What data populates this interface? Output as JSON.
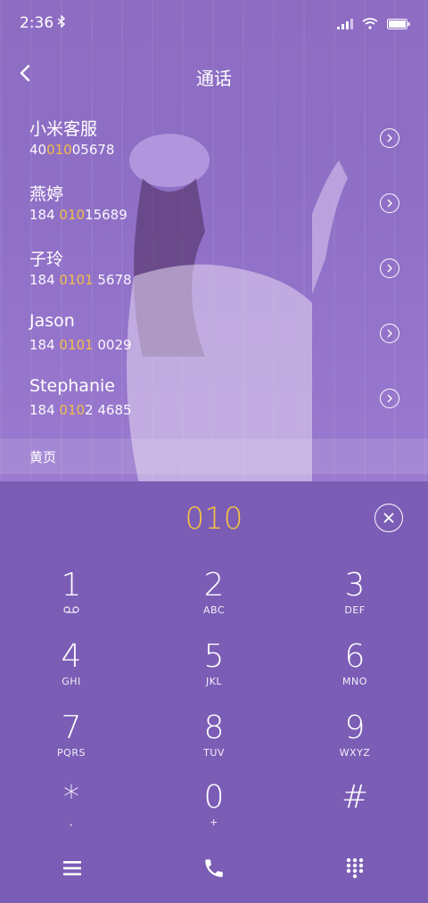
{
  "status_bar": {
    "time": "2:36"
  },
  "header": {
    "title": "通话"
  },
  "contacts": [
    {
      "name": "小米客服",
      "number_pre": "40",
      "number_hl": "010",
      "number_post": "05678"
    },
    {
      "name": "燕婷",
      "number_pre": "184 ",
      "number_hl": "010",
      "number_post": "15689"
    },
    {
      "name": "子玲",
      "number_pre": "184 ",
      "number_hl": "0101",
      "number_post": " 5678"
    },
    {
      "name": "Jason",
      "number_pre": "184 ",
      "number_hl": "0101",
      "number_post": " 0029"
    },
    {
      "name": "Stephanie",
      "number_pre": "184 ",
      "number_hl": "010",
      "number_post": "2 4685"
    }
  ],
  "yellow_pages": {
    "label": "黄页"
  },
  "dialer": {
    "typed_number": "010",
    "keys": [
      {
        "digit": "1",
        "letters": ""
      },
      {
        "digit": "2",
        "letters": "ABC"
      },
      {
        "digit": "3",
        "letters": "DEF"
      },
      {
        "digit": "4",
        "letters": "GHI"
      },
      {
        "digit": "5",
        "letters": "JKL"
      },
      {
        "digit": "6",
        "letters": "MNO"
      },
      {
        "digit": "7",
        "letters": "PQRS"
      },
      {
        "digit": "8",
        "letters": "TUV"
      },
      {
        "digit": "9",
        "letters": "WXYZ"
      },
      {
        "digit": "*",
        "letters": ","
      },
      {
        "digit": "0",
        "letters": "+"
      },
      {
        "digit": "#",
        "letters": ""
      }
    ]
  },
  "colors": {
    "accent": "#f6c342",
    "dialer_bg": "#7b5db6",
    "header_bg": "#8f6fc6"
  },
  "icons": [
    "bluetooth-icon",
    "signal-icon",
    "wifi-icon",
    "battery-icon",
    "back-icon",
    "chevron-right-icon",
    "clear-icon",
    "voicemail-icon",
    "menu-icon",
    "phone-icon",
    "keypad-icon"
  ]
}
